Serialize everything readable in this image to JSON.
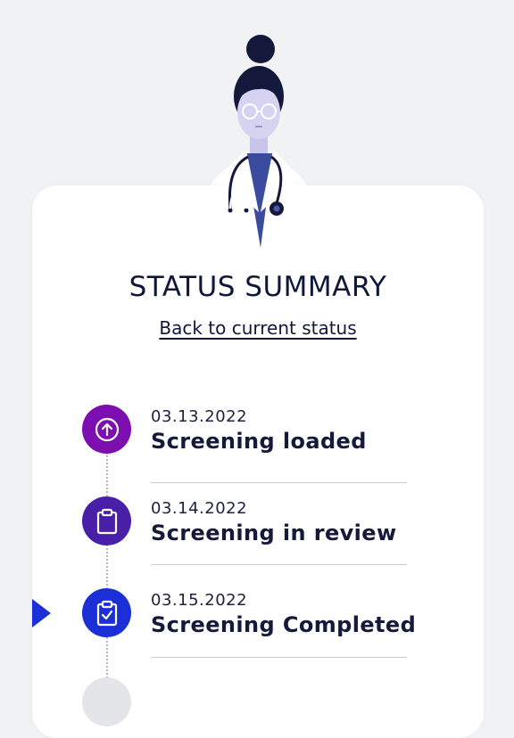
{
  "header": {
    "title": "STATUS SUMMARY",
    "back_link": "Back to current status"
  },
  "timeline": {
    "steps": [
      {
        "date": "03.13.2022",
        "label": "Screening loaded",
        "icon": "upload-arrow-icon",
        "color": "#7d0fb0"
      },
      {
        "date": "03.14.2022",
        "label": "Screening in review",
        "icon": "clipboard-icon",
        "color": "#4a1fa8"
      },
      {
        "date": "03.15.2022",
        "label": "Screening Completed",
        "icon": "clipboard-check-icon",
        "color": "#1b2fd6"
      }
    ],
    "current_step_index": 2
  },
  "colors": {
    "background": "#f1f2f4",
    "card": "#ffffff",
    "text": "#10183a",
    "marker": "#1b2fd6"
  }
}
